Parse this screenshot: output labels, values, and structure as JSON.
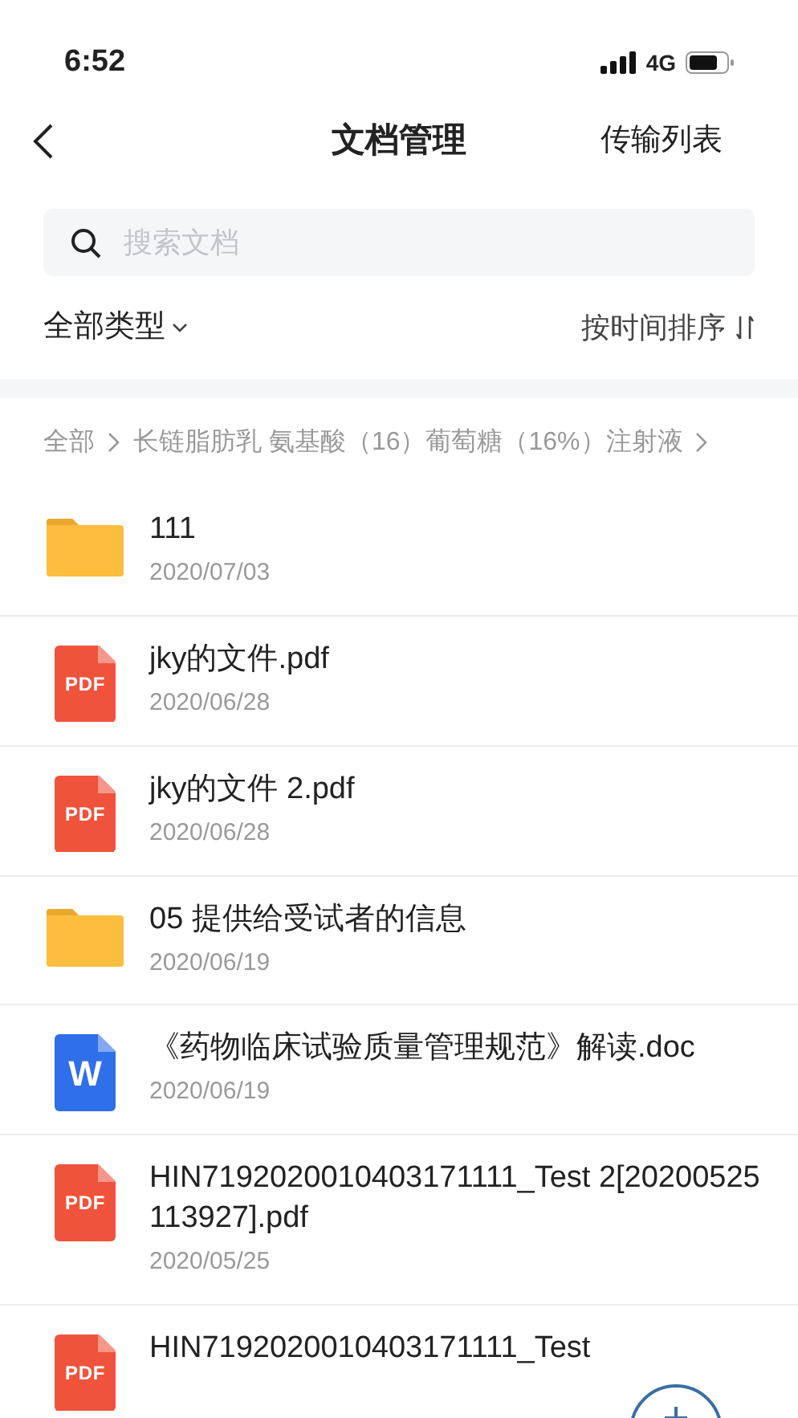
{
  "status_bar": {
    "time": "6:52",
    "network": "4G"
  },
  "nav": {
    "title": "文档管理",
    "action": "传输列表"
  },
  "search": {
    "placeholder": "搜索文档"
  },
  "filters": {
    "type": "全部类型",
    "sort": "按时间排序"
  },
  "breadcrumb": [
    "全部",
    "长链脂肪乳 氨基酸（16）葡萄糖（16%）注射液"
  ],
  "files": [
    {
      "kind": "folder",
      "name": "111",
      "date": "2020/07/03"
    },
    {
      "kind": "pdf",
      "badge": "PDF",
      "name": "jky的文件.pdf",
      "date": "2020/06/28"
    },
    {
      "kind": "pdf",
      "badge": "PDF",
      "name": "jky的文件 2.pdf",
      "date": "2020/06/28"
    },
    {
      "kind": "folder",
      "name": "05 提供给受试者的信息",
      "date": "2020/06/19"
    },
    {
      "kind": "doc",
      "badge": "W",
      "name": "《药物临床试验质量管理规范》解读.doc",
      "date": "2020/06/19"
    },
    {
      "kind": "pdf",
      "badge": "PDF",
      "name": "HIN7192020010403171111_Test 2[20200525113927].pdf",
      "date": "2020/05/25"
    },
    {
      "kind": "pdf",
      "badge": "PDF",
      "name": "HIN7192020010403171111_Test"
    }
  ]
}
